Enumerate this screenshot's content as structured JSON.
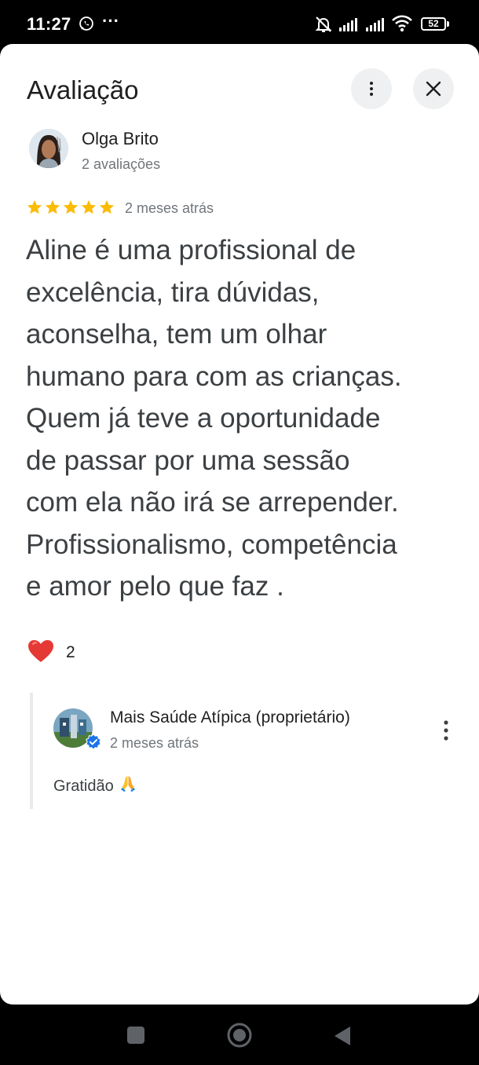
{
  "status_bar": {
    "time": "11:27",
    "dots": "···",
    "battery": "52"
  },
  "sheet": {
    "title": "Avaliação"
  },
  "review": {
    "reviewer_name": "Olga Brito",
    "reviewer_meta": "2 avaliações",
    "rating": 5,
    "date": "2 meses atrás",
    "text": "Aline é uma profissional de\nexcelência, tira dúvidas,\naconselha, tem um olhar\nhumano para com as crianças.\nQuem já teve a oportunidade\nde passar por uma sessão\ncom ela não irá se arrepender.\nProfissionalismo, competência\ne amor pelo que faz .",
    "reaction_count": "2"
  },
  "owner_reply": {
    "name": "Mais Saúde Atípica (proprietário)",
    "date": "2 meses atrás",
    "text": "Gratidão"
  },
  "icons": {
    "status": [
      "whatsapp-icon",
      "mute-icon",
      "signal-icon",
      "signal-icon",
      "wifi-icon",
      "battery-icon"
    ],
    "header": [
      "more-vert-icon",
      "close-icon"
    ],
    "reaction": "heart-icon",
    "reply": [
      "verified-icon",
      "more-vert-icon",
      "pray-emoji-icon"
    ],
    "nav": [
      "recent-apps-icon",
      "home-icon",
      "back-icon"
    ]
  },
  "colors": {
    "star": "#fbbc04",
    "heart": "#e53935",
    "verified": "#1a73e8",
    "text_primary": "#1f1f1f",
    "text_secondary": "#70757a"
  }
}
